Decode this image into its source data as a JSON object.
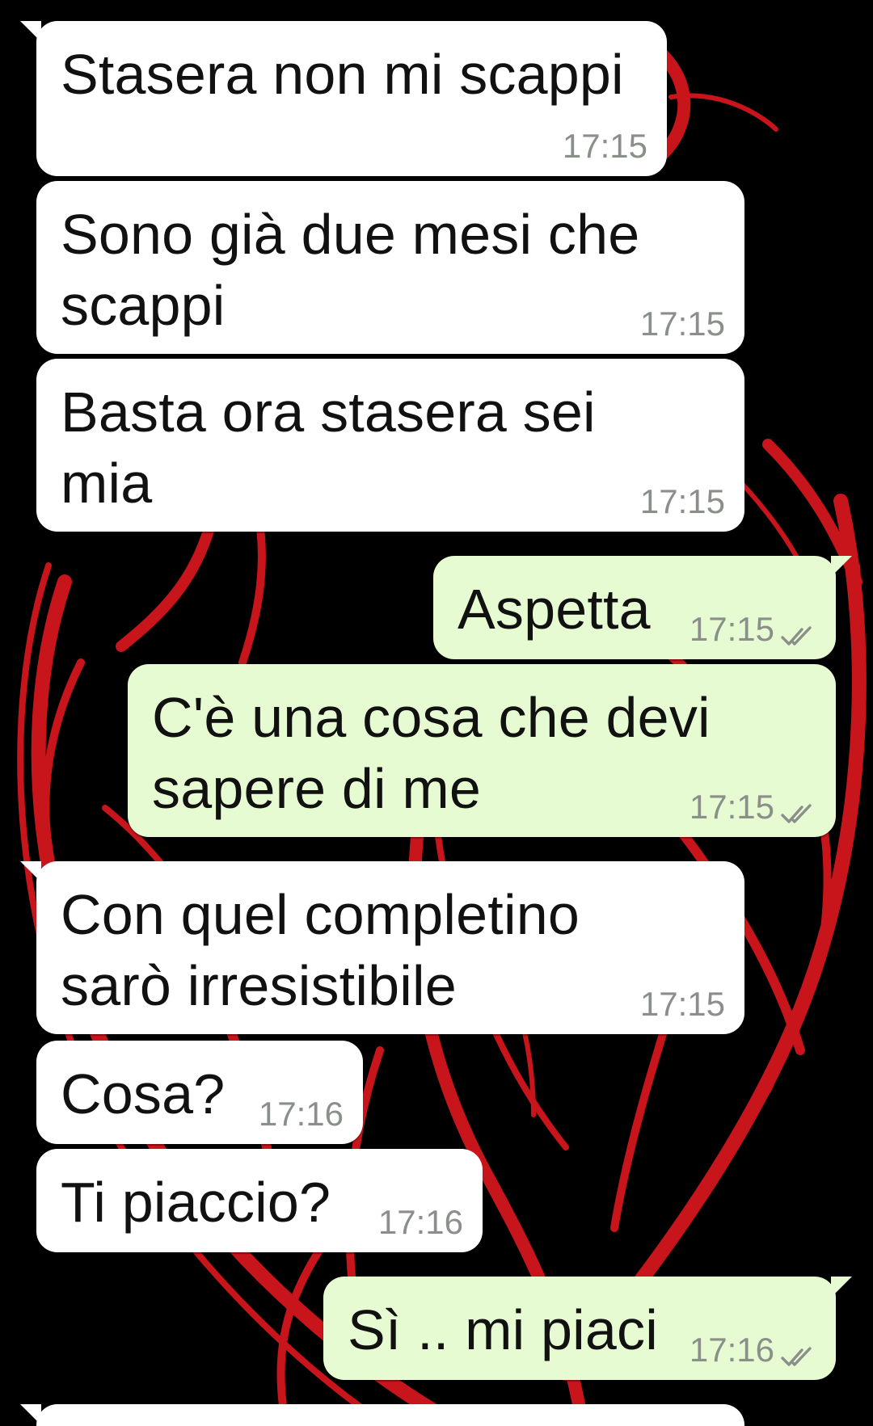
{
  "chat": {
    "messages": [
      {
        "direction": "in",
        "text": "Stasera non mi scappi",
        "time": "17:15"
      },
      {
        "direction": "in",
        "text": "Sono già due mesi che\nscappi",
        "time": "17:15"
      },
      {
        "direction": "in",
        "text": "Basta ora stasera sei\nmia",
        "time": "17:15"
      },
      {
        "direction": "out",
        "text": "Aspetta",
        "time": "17:15",
        "status_icon": "double-check-icon"
      },
      {
        "direction": "out",
        "text": "C'è una cosa che devi\nsapere di me",
        "time": "17:15",
        "status_icon": "double-check-icon"
      },
      {
        "direction": "in",
        "text": "Con quel completino\nsarò irresistibile",
        "time": "17:15"
      },
      {
        "direction": "in",
        "text": "Cosa?",
        "time": "17:16"
      },
      {
        "direction": "in",
        "text": "Ti piaccio?",
        "time": "17:16"
      },
      {
        "direction": "out",
        "text": "Sì .. mi piaci",
        "time": "17:16",
        "status_icon": "double-check-icon"
      }
    ]
  },
  "colors": {
    "incoming_bubble": "#ffffff",
    "outgoing_bubble": "#e7fbd3",
    "timestamp": "#8a8f8a",
    "wallpaper_background": "#000000",
    "wallpaper_art": "#c8141b"
  }
}
